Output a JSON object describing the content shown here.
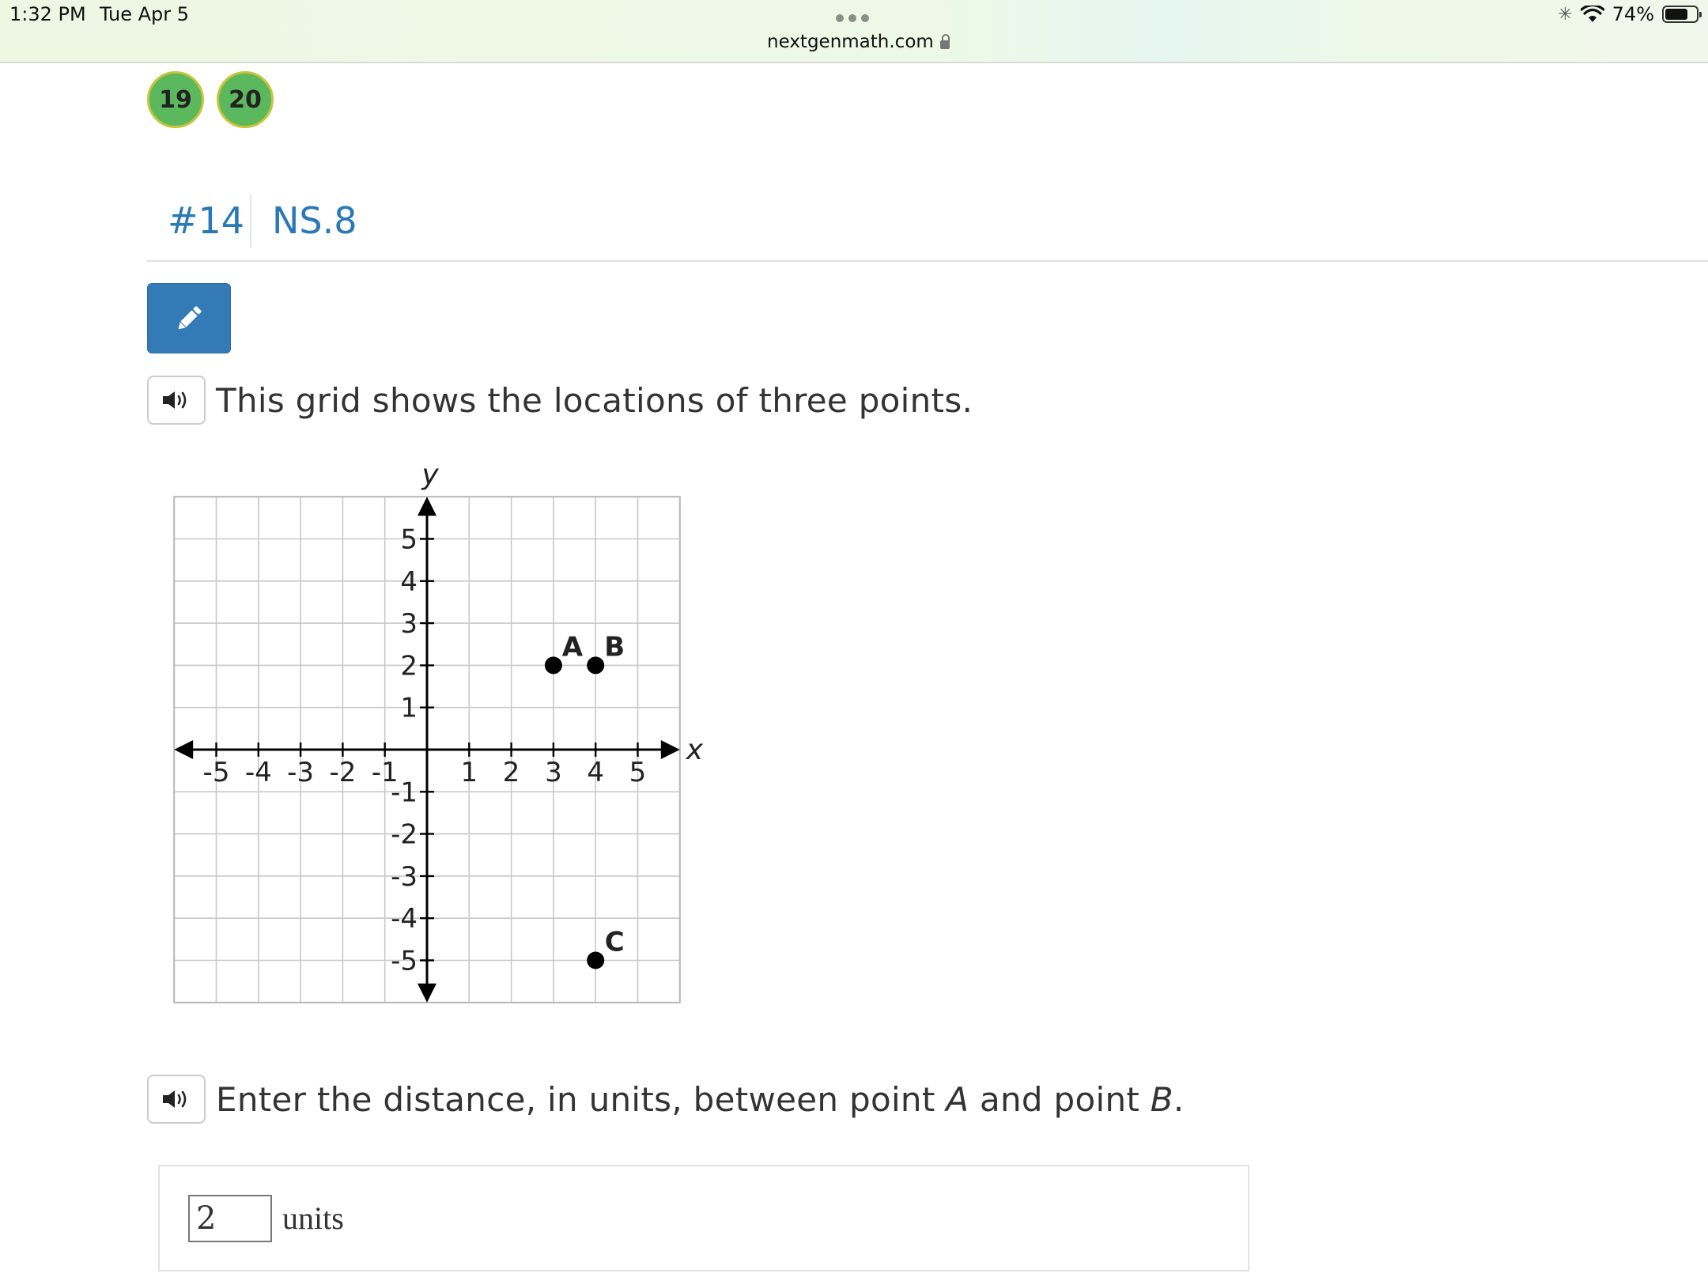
{
  "status_bar": {
    "time": "1:32 PM",
    "date": "Tue Apr 5",
    "url": "nextgenmath.com",
    "battery": "74%",
    "battery_level": 0.74
  },
  "question_nav": [
    {
      "label": "19",
      "color": "#5cb85c"
    },
    {
      "label": "20",
      "color": "#5cb85c"
    }
  ],
  "header": {
    "number": "#14",
    "standard": "NS.8"
  },
  "prompt1": "This grid shows the locations of three points.",
  "prompt2": {
    "before": "Enter the distance, in units, between point ",
    "a": "A",
    "middle": " and point ",
    "b": "B",
    "after": "."
  },
  "answer": {
    "value": "2",
    "units": "units"
  },
  "chart_data": {
    "type": "scatter",
    "xlabel": "x",
    "ylabel": "y",
    "xlim": [
      -5,
      5
    ],
    "ylim": [
      -5,
      5
    ],
    "grid": true,
    "x_tick_labels": [
      "-5",
      "-4",
      "-3",
      "-2",
      "-1",
      "1",
      "2",
      "3",
      "4",
      "5"
    ],
    "y_tick_labels": [
      "5",
      "4",
      "3",
      "2",
      "1",
      "-1",
      "-2",
      "-3",
      "-4",
      "-5"
    ],
    "points": [
      {
        "label": "A",
        "x": 3,
        "y": 2
      },
      {
        "label": "B",
        "x": 4,
        "y": 2
      },
      {
        "label": "C",
        "x": 4,
        "y": -5
      }
    ]
  }
}
